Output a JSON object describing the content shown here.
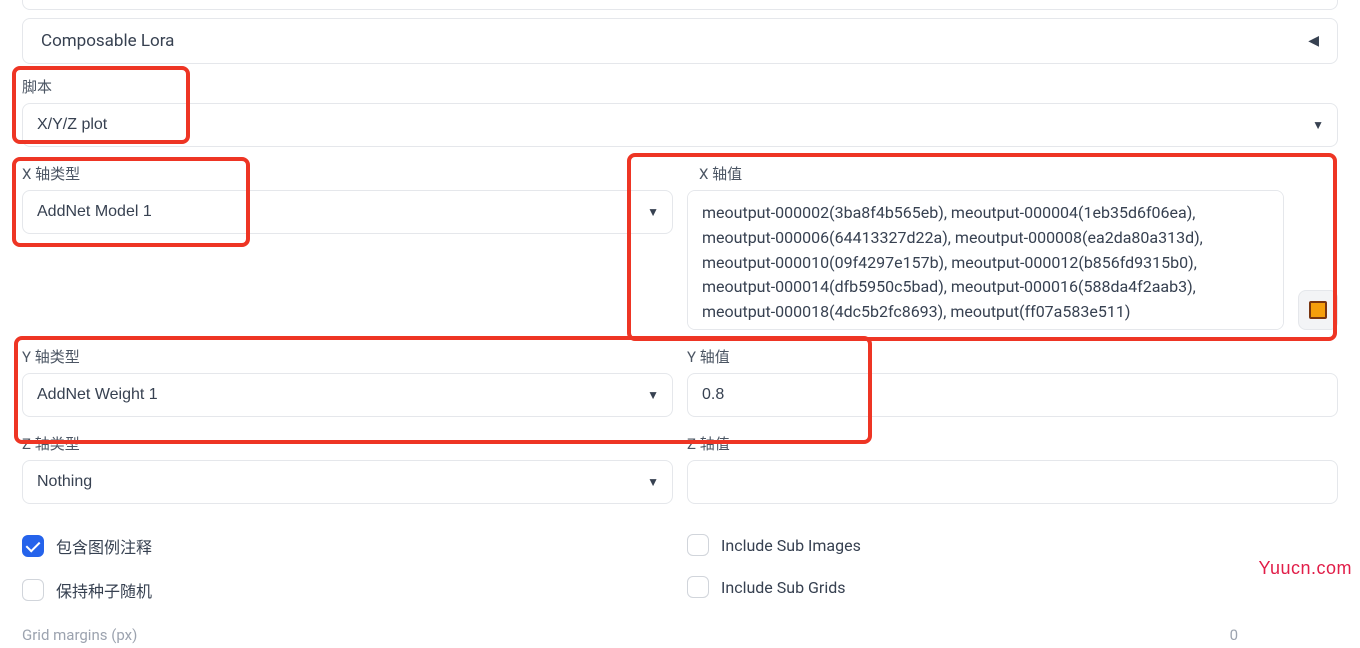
{
  "accordion": {
    "composable_lora": "Composable Lora"
  },
  "script": {
    "label": "脚本",
    "value": "X/Y/Z plot"
  },
  "x_axis": {
    "type_label": "X 轴类型",
    "type_value": "AddNet Model 1",
    "values_label": "X 轴值",
    "values": "meoutput-000002(3ba8f4b565eb), meoutput-000004(1eb35d6f06ea), meoutput-000006(64413327d22a), meoutput-000008(ea2da80a313d), meoutput-000010(09f4297e157b), meoutput-000012(b856fd9315b0), meoutput-000014(dfb5950c5bad), meoutput-000016(588da4f2aab3), meoutput-000018(4dc5b2fc8693), meoutput(ff07a583e511)"
  },
  "y_axis": {
    "type_label": "Y 轴类型",
    "type_value": "AddNet Weight 1",
    "values_label": "Y 轴值",
    "values": "0.8"
  },
  "z_axis": {
    "type_label": "Z 轴类型",
    "type_value": "Nothing",
    "values_label": "Z 轴值",
    "values": ""
  },
  "checks": {
    "legend": "包含图例注释",
    "keep_seed": "保持种子随机",
    "sub_images": "Include Sub Images",
    "sub_grids": "Include Sub Grids"
  },
  "grid_margins": {
    "label": "Grid margins (px)",
    "value": "0"
  },
  "watermark": "Yuucn.com"
}
